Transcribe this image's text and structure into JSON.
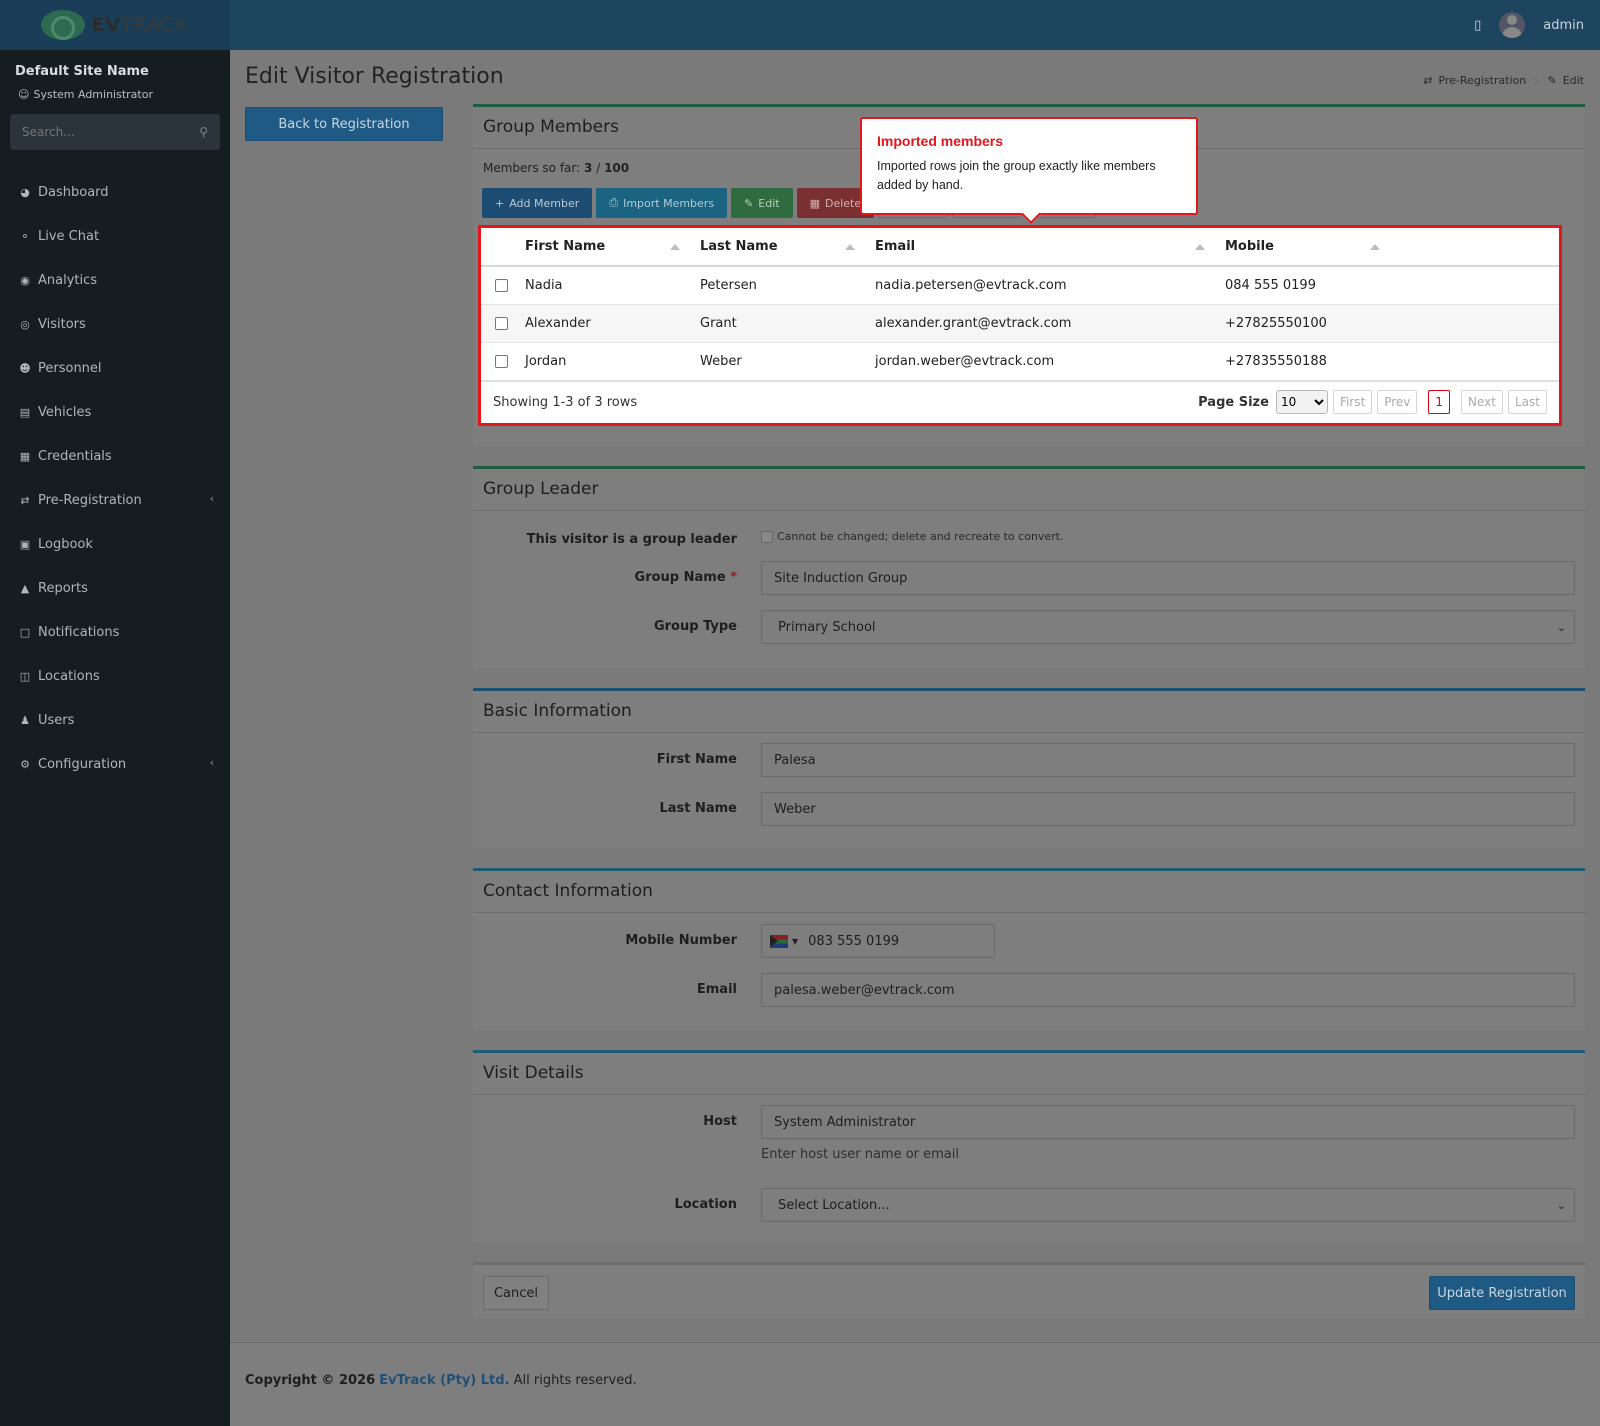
{
  "topbar": {
    "logo_text_a": "EV",
    "logo_text_b": "TRACK",
    "user": "admin"
  },
  "sidebar": {
    "site_name": "Default Site Name",
    "role": "System Administrator",
    "search_placeholder": "Search...",
    "items": [
      {
        "label": "Dashboard",
        "icon": "gauge-icon"
      },
      {
        "label": "Live Chat",
        "icon": "headset-icon"
      },
      {
        "label": "Analytics",
        "icon": "target-icon"
      },
      {
        "label": "Visitors",
        "icon": "eye-icon"
      },
      {
        "label": "Personnel",
        "icon": "user-tie-icon"
      },
      {
        "label": "Vehicles",
        "icon": "car-icon"
      },
      {
        "label": "Credentials",
        "icon": "id-card-icon"
      },
      {
        "label": "Pre-Registration",
        "icon": "exchange-icon",
        "expandable": true
      },
      {
        "label": "Logbook",
        "icon": "book-icon"
      },
      {
        "label": "Reports",
        "icon": "chart-icon"
      },
      {
        "label": "Notifications",
        "icon": "comment-icon"
      },
      {
        "label": "Locations",
        "icon": "map-icon"
      },
      {
        "label": "Users",
        "icon": "users-icon"
      },
      {
        "label": "Configuration",
        "icon": "gear-icon",
        "expandable": true
      }
    ]
  },
  "page": {
    "title": "Edit Visitor Registration",
    "back_button": "Back to Registration",
    "breadcrumb": [
      "Pre-Registration",
      "Edit"
    ]
  },
  "group_members": {
    "title": "Group Members",
    "count_label": "Members so far:",
    "count_current": "3",
    "count_sep": "/",
    "count_max": "100",
    "buttons": {
      "add": "Add Member",
      "import": "Import Members",
      "edit": "Edit",
      "delete": "Delete"
    },
    "columns": [
      "First Name",
      "Last Name",
      "Email",
      "Mobile"
    ],
    "rows": [
      {
        "first": "Nadia",
        "last": "Petersen",
        "email": "nadia.petersen@evtrack.com",
        "mobile": "084 555 0199"
      },
      {
        "first": "Alexander",
        "last": "Grant",
        "email": "alexander.grant@evtrack.com",
        "mobile": "+27825550100"
      },
      {
        "first": "Jordan",
        "last": "Weber",
        "email": "jordan.weber@evtrack.com",
        "mobile": "+27835550188"
      }
    ],
    "showing": "Showing 1-3 of 3 rows",
    "page_size_label": "Page Size",
    "page_size": "10",
    "pager": {
      "first": "First",
      "prev": "Prev",
      "current": "1",
      "next": "Next",
      "last": "Last"
    }
  },
  "tooltip": {
    "title": "Imported members",
    "body": "Imported rows join the group exactly like members added by hand."
  },
  "group_leader": {
    "title": "Group Leader",
    "leader_label": "This visitor is a group leader",
    "leader_note": "Cannot be changed; delete and recreate to convert.",
    "group_name_label": "Group Name",
    "group_name_req": "*",
    "group_name": "Site Induction Group",
    "group_type_label": "Group Type",
    "group_type": "Primary School"
  },
  "basic_info": {
    "title": "Basic Information",
    "first_label": "First Name",
    "first": "Palesa",
    "last_label": "Last Name",
    "last": "Weber"
  },
  "contact_info": {
    "title": "Contact Information",
    "mobile_label": "Mobile Number",
    "mobile": "083 555 0199",
    "email_label": "Email",
    "email": "palesa.weber@evtrack.com"
  },
  "visit_details": {
    "title": "Visit Details",
    "host_label": "Host",
    "host": "System Administrator",
    "host_help": "Enter host user name or email",
    "location_label": "Location",
    "location": "Select Location..."
  },
  "actions": {
    "cancel": "Cancel",
    "update": "Update Registration"
  },
  "footer": {
    "prefix": "Copyright © 2026",
    "company": "EvTrack (Pty) Ltd.",
    "suffix": "All rights reserved."
  }
}
